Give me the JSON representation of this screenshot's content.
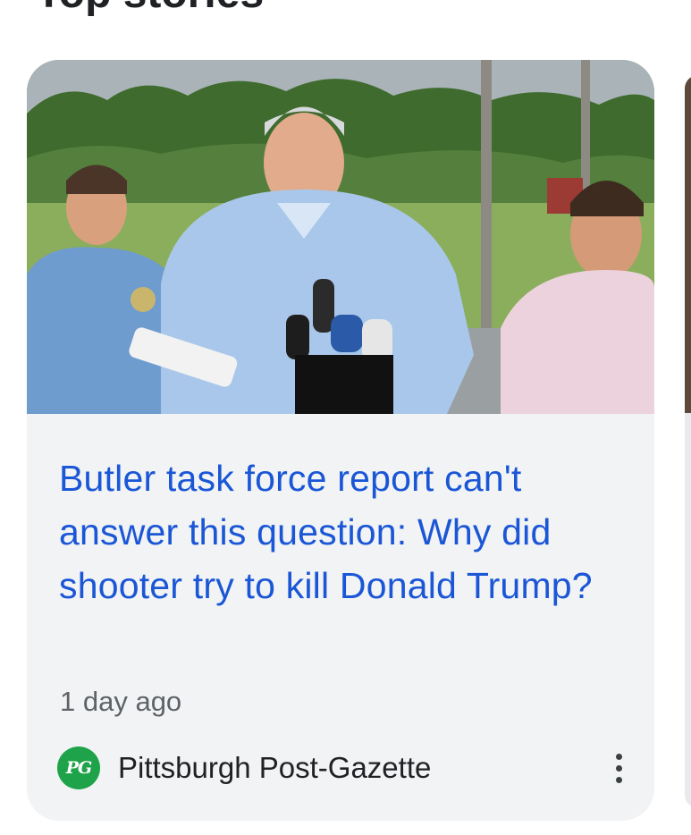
{
  "section": {
    "title": "Top stories"
  },
  "story": {
    "image_alt": "Man in light blue shirt speaking at microphones outdoors, flanked by two men",
    "headline": "Butler task force report can't answer this question: Why did shooter try to kill Donald Trump?",
    "timestamp": "1 day ago",
    "publisher": {
      "name": "Pittsburgh Post-Gazette",
      "logo_text": "PG",
      "logo_color": "#1fa34a"
    },
    "more_icon": "more-vert-icon"
  },
  "colors": {
    "headline": "#1a56d6",
    "card_background": "#f1f3f4",
    "secondary_text": "#5f6368"
  }
}
